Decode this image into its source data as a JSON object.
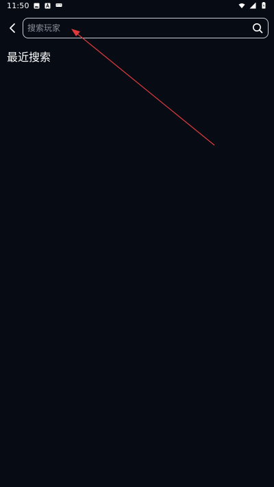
{
  "status_bar": {
    "time": "11:50"
  },
  "search": {
    "placeholder": "搜索玩家",
    "value": ""
  },
  "recent": {
    "title": "最近搜索"
  },
  "colors": {
    "background": "#070b14",
    "search_border": "#c9cdd6",
    "placeholder": "#8a8f99",
    "annotation_arrow": "#e0393e"
  },
  "icons": {
    "back": "back-icon",
    "search": "search-icon"
  }
}
